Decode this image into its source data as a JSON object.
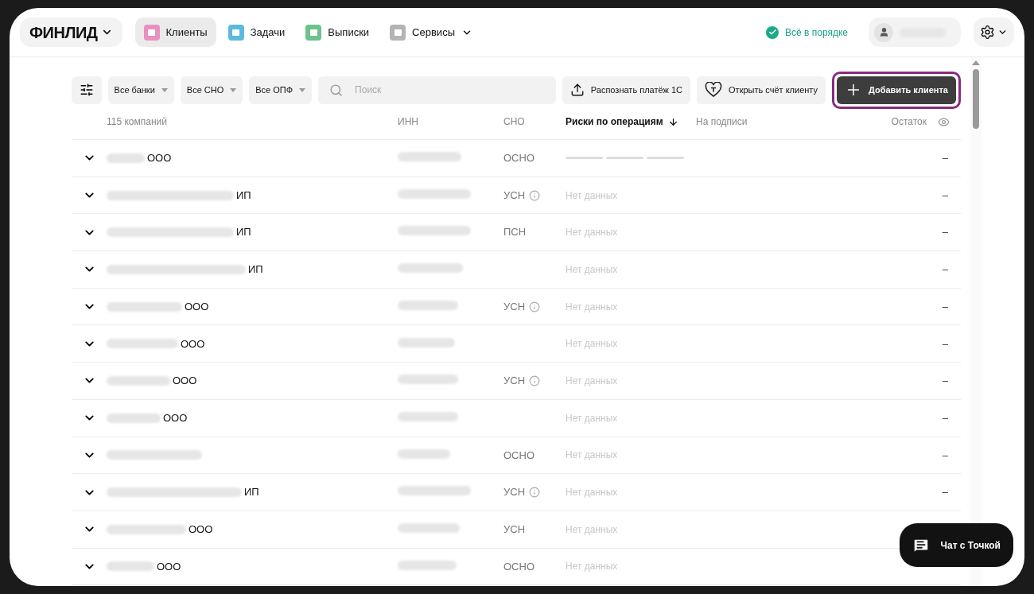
{
  "header": {
    "logo": "ФИНЛИД",
    "nav": [
      {
        "label": "Клиенты",
        "selected": true,
        "color": "#e991c0",
        "has_menu": false
      },
      {
        "label": "Задачи",
        "selected": false,
        "color": "#5cb9de",
        "has_menu": false
      },
      {
        "label": "Выписки",
        "selected": false,
        "color": "#6cc28c",
        "has_menu": false
      },
      {
        "label": "Сервисы",
        "selected": false,
        "color": "#b4b4b4",
        "has_menu": true
      }
    ],
    "status": "Всё в порядке"
  },
  "toolbar": {
    "filters": [
      "Все банки",
      "Все СНО",
      "Все ОПФ"
    ],
    "search": {
      "placeholder": "Поиск"
    },
    "actions": [
      {
        "kind": "upload",
        "label": "Распознать платёж 1С",
        "highlighted": false
      },
      {
        "kind": "account",
        "label": "Открыть счёт клиенту",
        "highlighted": false
      },
      {
        "kind": "add",
        "label": "Добавить клиента",
        "highlighted": true
      }
    ]
  },
  "table": {
    "columns": [
      {
        "label": "115 компаний",
        "sorted": false
      },
      {
        "label": "ИНН",
        "sorted": false
      },
      {
        "label": "СНО",
        "sorted": false
      },
      {
        "label": "Риски по операциям",
        "sorted": true
      },
      {
        "label": "На подписи",
        "sorted": false
      },
      {
        "label": "Остаток",
        "sorted": false
      }
    ],
    "rows": [
      {
        "suffix": "ООО",
        "tax": "ОСНО",
        "tax_info": false,
        "risk_loading": true,
        "balance": "–"
      },
      {
        "suffix": "ИП",
        "tax": "УСН",
        "tax_info": true,
        "risk_loading": false,
        "risk": "Нет данных",
        "balance": "–"
      },
      {
        "suffix": "ИП",
        "tax": "ПСН",
        "tax_info": false,
        "risk_loading": false,
        "risk": "Нет данных",
        "balance": "–"
      },
      {
        "suffix": "ИП",
        "tax_info": false,
        "risk_loading": false,
        "risk": "Нет данных",
        "balance": "–"
      },
      {
        "suffix": "ООО",
        "tax": "УСН",
        "tax_info": true,
        "risk_loading": false,
        "risk": "Нет данных",
        "balance": "–"
      },
      {
        "suffix": "ООО",
        "tax_info": false,
        "risk_loading": false,
        "risk": "Нет данных",
        "balance": "–"
      },
      {
        "suffix": "ООО",
        "tax": "УСН",
        "tax_info": true,
        "risk_loading": false,
        "risk": "Нет данных",
        "balance": "–"
      },
      {
        "suffix": "ООО",
        "tax_info": false,
        "risk_loading": false,
        "risk": "Нет данных",
        "balance": "–"
      },
      {
        "tax": "ОСНО",
        "tax_info": false,
        "risk_loading": false,
        "risk": "Нет данных",
        "balance": "–"
      },
      {
        "suffix": "ИП",
        "tax": "УСН",
        "tax_info": true,
        "risk_loading": false,
        "risk": "Нет данных",
        "balance": "–"
      },
      {
        "suffix": "ООО",
        "tax": "УСН",
        "tax_info": false,
        "risk_loading": false,
        "risk": "Нет данных"
      },
      {
        "suffix": "ООО",
        "tax": "ОСНО",
        "tax_info": false,
        "risk_loading": false,
        "risk": "Нет данных"
      }
    ]
  },
  "chat": {
    "label": "Чат с Точкой"
  }
}
